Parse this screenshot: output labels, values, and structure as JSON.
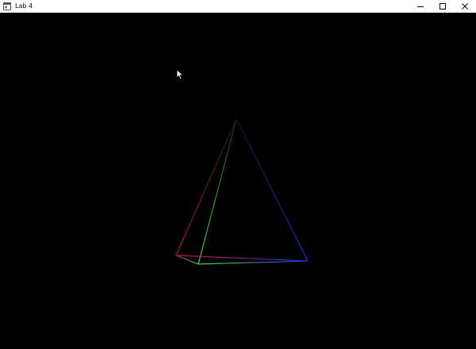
{
  "window": {
    "title": "Lab 4",
    "icon": "app-window-icon",
    "controls": [
      "minimize-icon",
      "maximize-icon",
      "close-icon"
    ]
  },
  "viewport": {
    "background": "#000000",
    "pyramid": {
      "edges": [
        {
          "name": "apex-to-left-base",
          "color": "#c0192f"
        },
        {
          "name": "apex-to-front-base",
          "color": "#2ecc40"
        },
        {
          "name": "apex-to-right-base",
          "color": "#1f2bd6"
        },
        {
          "name": "base-left-to-front",
          "color": "#c0192f"
        },
        {
          "name": "base-front-to-right",
          "color": "#2ecc40"
        },
        {
          "name": "base-left-to-right",
          "color": "#8a1e3c"
        }
      ]
    }
  }
}
